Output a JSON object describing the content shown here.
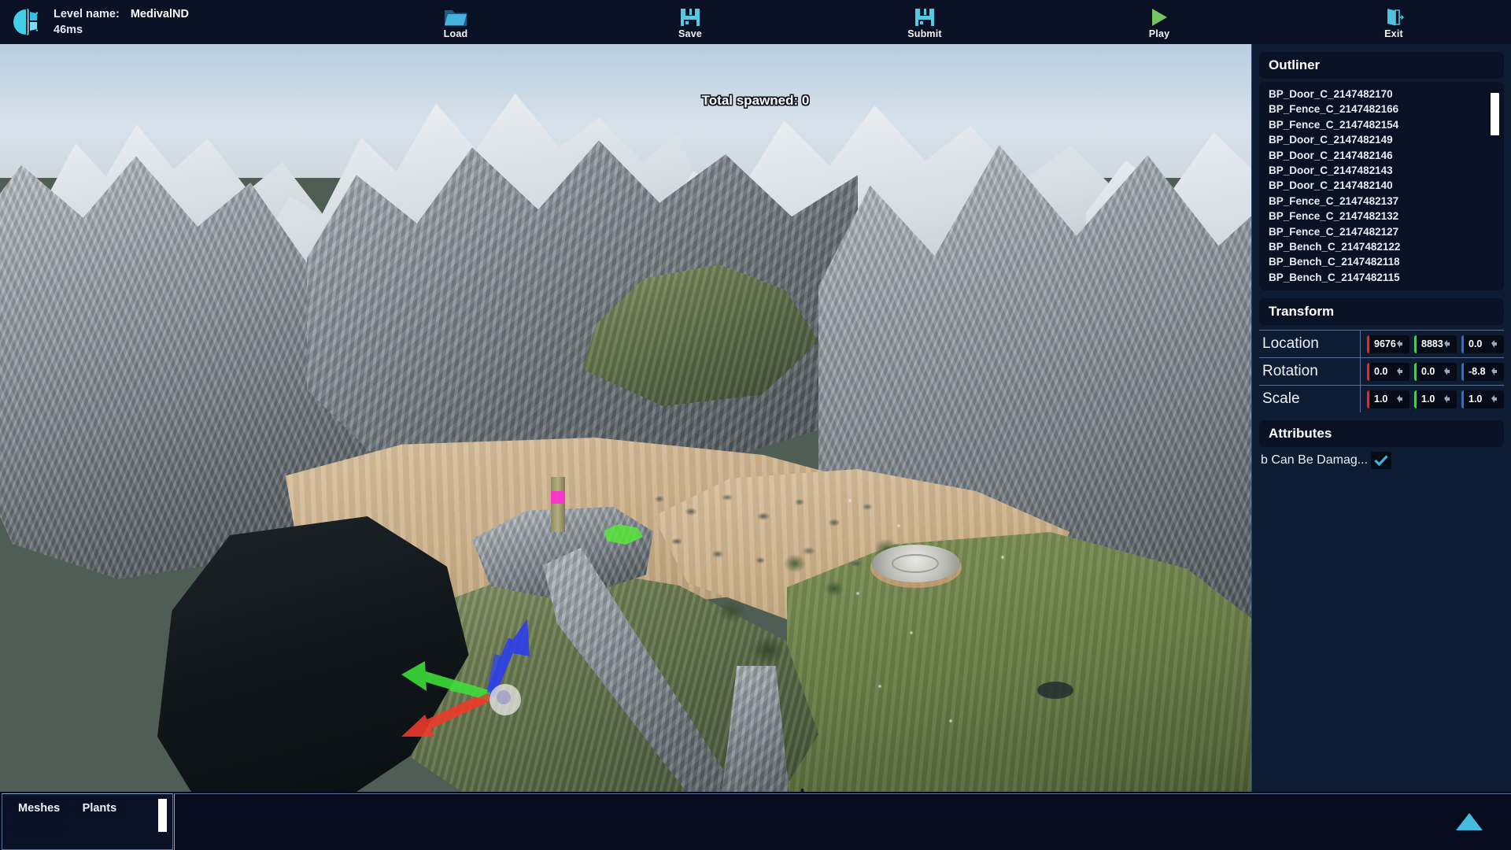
{
  "header": {
    "level_label": "Level name:",
    "level_value": "MedivalND",
    "frame_time": "46ms",
    "logo_icon": "level-editor-logo-icon",
    "tools": [
      {
        "label": "Load",
        "icon": "folder-open-icon"
      },
      {
        "label": "Save",
        "icon": "floppy-disk-icon"
      },
      {
        "label": "Submit",
        "icon": "floppy-disk-icon"
      },
      {
        "label": "Play",
        "icon": "play-triangle-icon"
      },
      {
        "label": "Exit",
        "icon": "exit-door-icon"
      }
    ]
  },
  "viewport": {
    "spawned_label": "Total spawned:",
    "spawned_count": "0",
    "gizmo_tools": [
      {
        "name": "translate-gizmo-icon"
      },
      {
        "name": "rotate-gizmo-icon"
      },
      {
        "name": "scale-gizmo-icon"
      },
      {
        "name": "pivot-gizmo-icon"
      },
      {
        "name": "global-axis-gizmo-icon"
      }
    ],
    "collapse_icon": "collapse-left-arrow-icon"
  },
  "outliner": {
    "title": "Outliner",
    "items": [
      "BP_Door_C_2147482170",
      "BP_Fence_C_2147482166",
      "BP_Fence_C_2147482154",
      "BP_Door_C_2147482149",
      "BP_Door_C_2147482146",
      "BP_Door_C_2147482143",
      "BP_Door_C_2147482140",
      "BP_Fence_C_2147482137",
      "BP_Fence_C_2147482132",
      "BP_Fence_C_2147482127",
      "BP_Bench_C_2147482122",
      "BP_Bench_C_2147482118",
      "BP_Bench_C_2147482115"
    ]
  },
  "transform": {
    "title": "Transform",
    "rows": [
      {
        "label": "Location",
        "x": "9676",
        "y": "8883",
        "z": "0.0"
      },
      {
        "label": "Rotation",
        "x": "0.0",
        "y": "0.0",
        "z": "-8.8"
      },
      {
        "label": "Scale",
        "x": "1.0",
        "y": "1.0",
        "z": "1.0"
      }
    ]
  },
  "attributes": {
    "title": "Attributes",
    "items": [
      {
        "label": "b Can Be Damag...",
        "checked": true,
        "icon": "checkmark-icon"
      }
    ]
  },
  "bottom": {
    "categories": [
      "Meshes",
      "Plants",
      ""
    ],
    "expand_icon": "expand-up-arrow-icon"
  },
  "colors": {
    "accent": "#45bcdd",
    "panel_bg": "#0d1b33",
    "header_bg": "#0b1124",
    "axis_x": "#ff1f1f",
    "axis_y": "#18f018",
    "axis_z": "#2f6fd0",
    "play_green": "#76c362"
  }
}
